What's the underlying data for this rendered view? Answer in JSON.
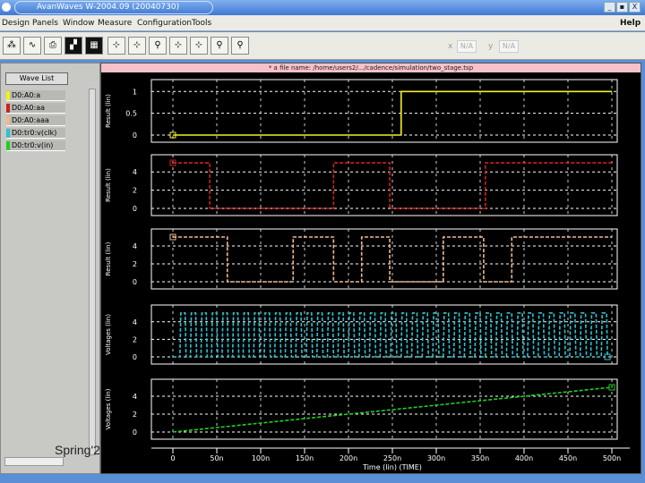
{
  "window": {
    "title": "AvanWaves W-2004.09 (20040730)",
    "min": "_",
    "max": "▪",
    "close": "X"
  },
  "menu": {
    "items": [
      "Design",
      "Panels",
      "Window",
      "Measure",
      "Configuration",
      "Tools"
    ],
    "help": "Help"
  },
  "toolbar": {
    "icons": [
      "hierarchy-icon",
      "waveform-icon",
      "print-icon",
      "panel-icon",
      "panel-grid-icon",
      "cursor-1-icon",
      "cursor-2-icon",
      "cursor-3-icon",
      "cursor-4-icon",
      "cursor-5-icon",
      "cursor-6-icon",
      "cursor-7-icon"
    ],
    "x_label": "x",
    "x_value": "N/A",
    "y_label": "y",
    "y_value": "N/A"
  },
  "wave_list": {
    "title": "Wave List",
    "items": [
      {
        "label": "D0:A0:a",
        "color": "#f0f020"
      },
      {
        "label": "D0:A0:aa",
        "color": "#d02020"
      },
      {
        "label": "D0:A0:aaa",
        "color": "#f0b890"
      },
      {
        "label": "D0:tr0:v(clk)",
        "color": "#30c0d0"
      },
      {
        "label": "D0:tr0:v(in)",
        "color": "#20d020"
      }
    ]
  },
  "watermark": "Spring'2",
  "file_path": "* a file name: /home/users2/.../cadence/simulation/two_stage.tsp",
  "chart_data": [
    {
      "type": "line",
      "name": "a",
      "ylabel": "Result (lin)",
      "yticks": [
        "0",
        "0.5",
        "1"
      ],
      "ylim": [
        0,
        1.15
      ],
      "color": "#f0f020",
      "points": [
        [
          0,
          0
        ],
        [
          260,
          0
        ],
        [
          260,
          1
        ],
        [
          500,
          1
        ]
      ]
    },
    {
      "type": "line",
      "name": "aa",
      "ylabel": "Result (lin)",
      "yticks": [
        "0",
        "2",
        "4"
      ],
      "ylim": [
        0,
        5.3
      ],
      "color": "#d02020",
      "points": [
        [
          0,
          5
        ],
        [
          42,
          5
        ],
        [
          42,
          0
        ],
        [
          183,
          0
        ],
        [
          183,
          5
        ],
        [
          247,
          5
        ],
        [
          247,
          0
        ],
        [
          356,
          0
        ],
        [
          356,
          5
        ],
        [
          500,
          5
        ]
      ]
    },
    {
      "type": "line",
      "name": "aaa",
      "ylabel": "Result (lin)",
      "yticks": [
        "0",
        "2",
        "4"
      ],
      "ylim": [
        0,
        5.3
      ],
      "color": "#f0b890",
      "points": [
        [
          0,
          5
        ],
        [
          62,
          5
        ],
        [
          62,
          0
        ],
        [
          137,
          0
        ],
        [
          137,
          5
        ],
        [
          183,
          5
        ],
        [
          183,
          0
        ],
        [
          215,
          0
        ],
        [
          215,
          5
        ],
        [
          247,
          5
        ],
        [
          247,
          0
        ],
        [
          308,
          0
        ],
        [
          308,
          5
        ],
        [
          354,
          5
        ],
        [
          354,
          0
        ],
        [
          386,
          0
        ],
        [
          386,
          5
        ],
        [
          500,
          5
        ]
      ]
    },
    {
      "type": "line",
      "name": "v(clk)",
      "ylabel": "Voltages (lin)",
      "yticks": [
        "0",
        "2",
        "4"
      ],
      "ylim": [
        0,
        5.3
      ],
      "color": "#30c0d0",
      "clock": {
        "start": 8,
        "period": 12,
        "high": 5,
        "end": 500
      }
    },
    {
      "type": "line",
      "name": "v(in)",
      "ylabel": "Voltages (lin)",
      "yticks": [
        "0",
        "2",
        "4"
      ],
      "ylim": [
        0,
        5.3
      ],
      "color": "#20d020",
      "points": [
        [
          0,
          0
        ],
        [
          500,
          5
        ]
      ]
    }
  ],
  "xaxis": {
    "label": "Time (lin) (TIME)",
    "ticks": [
      "0",
      "50n",
      "100n",
      "150n",
      "200n",
      "250n",
      "300n",
      "350n",
      "400n",
      "450n",
      "500n"
    ],
    "xlim": [
      0,
      500
    ]
  }
}
